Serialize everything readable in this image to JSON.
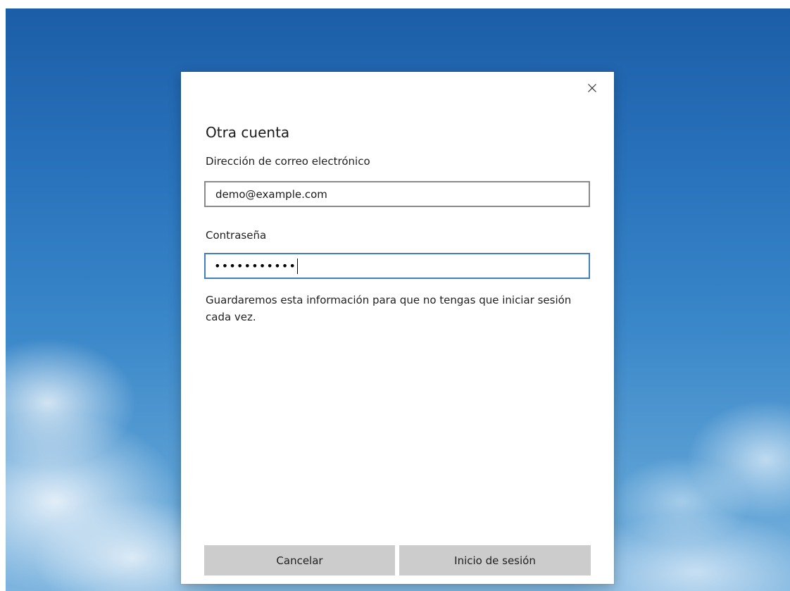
{
  "dialog": {
    "title": "Otra cuenta",
    "email_label": "Dirección de correo electrónico",
    "email_value": "demo@example.com",
    "password_label": "Contraseña",
    "password_mask": "•••••••••••",
    "info_text": "Guardaremos esta información para que no tengas que iniciar sesión cada vez.",
    "cancel_label": "Cancelar",
    "signin_label": "Inicio de sesión",
    "close_icon": "close-icon"
  },
  "colors": {
    "focus_border": "#3f7fbf",
    "button_bg": "#cccccc",
    "desktop_sky": "#2a74bd"
  }
}
